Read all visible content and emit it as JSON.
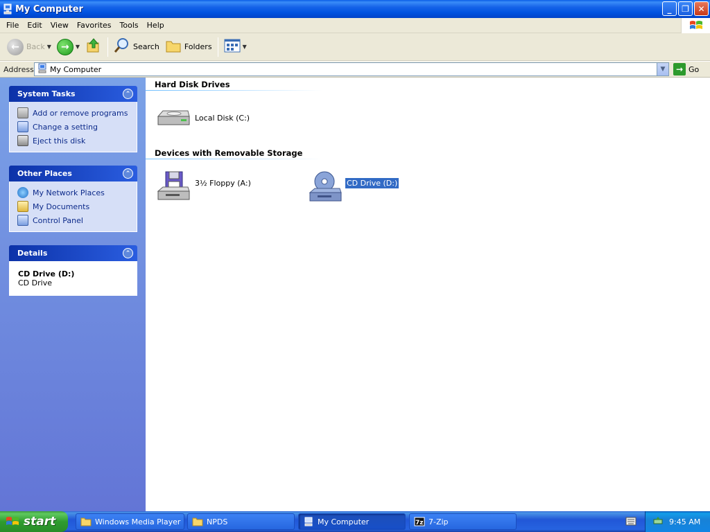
{
  "window": {
    "title": "My Computer",
    "buttons": {
      "minimize": "_",
      "maximize": "❐",
      "close": "✕"
    }
  },
  "menubar": {
    "items": [
      "File",
      "Edit",
      "View",
      "Favorites",
      "Tools",
      "Help"
    ]
  },
  "toolbar": {
    "back_label": "Back",
    "search_label": "Search",
    "folders_label": "Folders"
  },
  "addressbar": {
    "label": "Address",
    "value": "My Computer",
    "go_label": "Go"
  },
  "taskpane": {
    "system_tasks": {
      "title": "System Tasks",
      "items": [
        "Add or remove programs",
        "Change a setting",
        "Eject this disk"
      ]
    },
    "other_places": {
      "title": "Other Places",
      "items": [
        "My Network Places",
        "My Documents",
        "Control Panel"
      ]
    },
    "details": {
      "title": "Details",
      "name": "CD Drive (D:)",
      "type": "CD Drive"
    }
  },
  "content": {
    "groups": [
      {
        "title": "Hard Disk Drives",
        "items": [
          {
            "label": "Local Disk (C:)",
            "icon": "hard-disk-icon"
          }
        ]
      },
      {
        "title": "Devices with Removable Storage",
        "items": [
          {
            "label": "3½ Floppy (A:)",
            "icon": "floppy-drive-icon"
          },
          {
            "label": "CD Drive (D:)",
            "icon": "cd-drive-icon",
            "selected": true
          }
        ]
      }
    ]
  },
  "taskbar": {
    "start_label": "start",
    "tasks": [
      {
        "label": "Windows Media Player",
        "active": false
      },
      {
        "label": "NPDS",
        "active": false
      },
      {
        "label": "My Computer",
        "active": true
      },
      {
        "label": "7-Zip",
        "active": false
      }
    ],
    "clock": "9:45 AM"
  },
  "colors": {
    "title_bar": "#0052e0",
    "task_pane": "#6b8ce0",
    "selection": "#316ac5",
    "start_button": "#2f9c2f"
  }
}
